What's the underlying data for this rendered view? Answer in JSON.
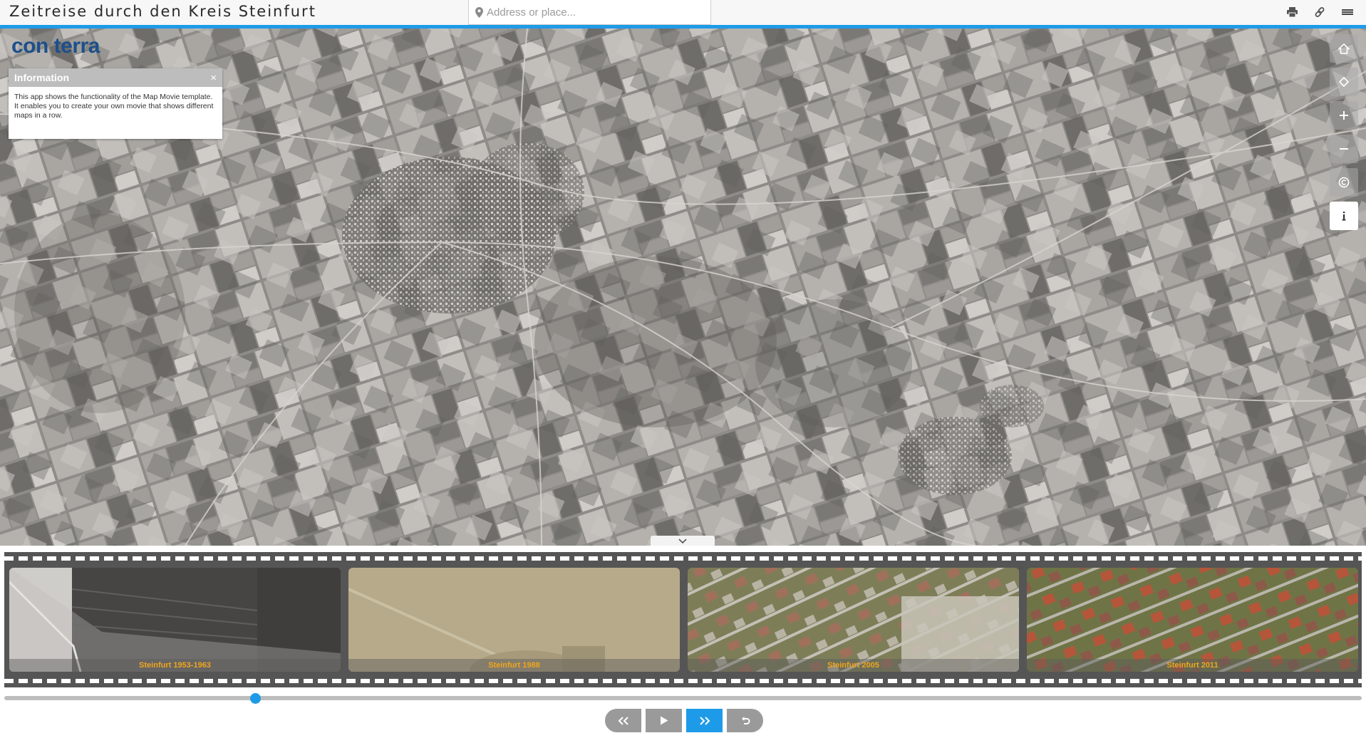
{
  "header": {
    "title": "Zeitreise durch den Kreis Steinfurt",
    "search": {
      "placeholder": "Address or place...",
      "value": ""
    },
    "buttons": {
      "print_icon": "print-icon",
      "link_icon": "link-icon",
      "menu_icon": "menu-icon"
    }
  },
  "map": {
    "logo_text": "con terra",
    "info_panel": {
      "title": "Information",
      "close": "×",
      "body": "This app shows the functionality of the Map Movie template. It enables you to create your own movie that shows different maps in a row."
    },
    "toolbar": [
      {
        "name": "home-icon",
        "glyph": "⌂"
      },
      {
        "name": "locate-icon",
        "glyph": "◇"
      },
      {
        "name": "zoom-in-icon",
        "glyph": "+"
      },
      {
        "name": "zoom-out-icon",
        "glyph": "−"
      },
      {
        "name": "copyright-icon",
        "glyph": "©"
      },
      {
        "name": "info-icon",
        "glyph": "i"
      }
    ]
  },
  "filmstrip": {
    "frames": [
      {
        "label": "Steinfurt 1953-1963"
      },
      {
        "label": "Steinfurt 1988"
      },
      {
        "label": "Steinfurt 2005"
      },
      {
        "label": "Steinfurt 2011"
      }
    ],
    "slider_fraction": 0.185
  },
  "controls": {
    "rewind_icon": "double-chevron-left-icon",
    "play_icon": "play-icon",
    "forward_icon": "double-chevron-right-icon",
    "reset_icon": "undo-icon",
    "active": "forward"
  },
  "colors": {
    "accent": "#1e9be8",
    "frame_label": "#f0a51c",
    "film": "#555555",
    "logo": "#1d4f8c"
  }
}
